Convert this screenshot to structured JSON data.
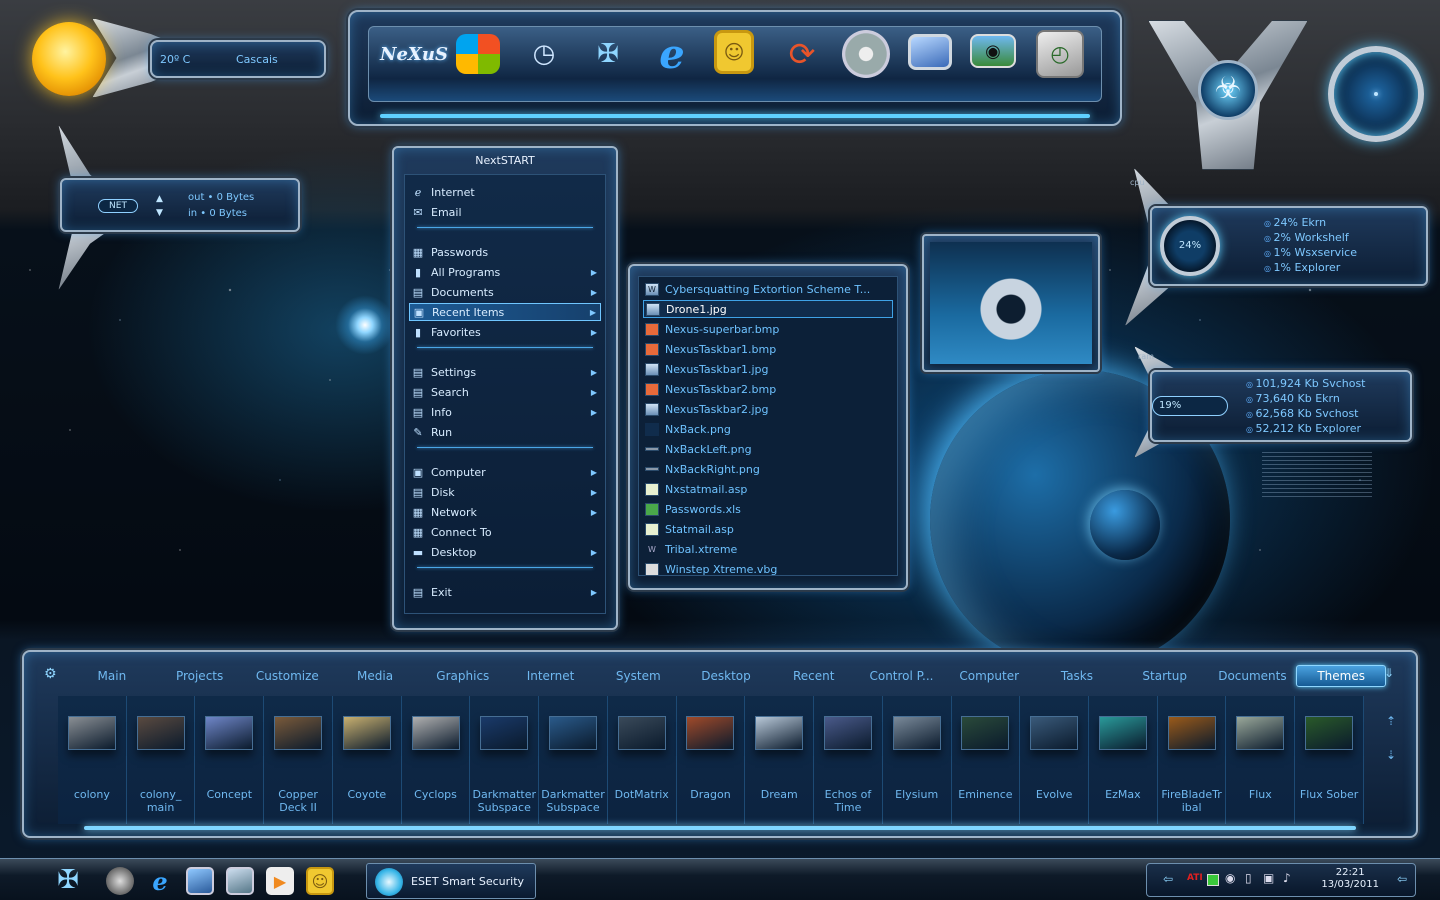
{
  "weather": {
    "temp": "20º C",
    "city": "Cascais"
  },
  "net": {
    "badge": "NET",
    "out": "out • 0 Bytes",
    "in": "in • 0 Bytes"
  },
  "dock": {
    "logo": "NeXuS",
    "icons": [
      "windows-logo-icon",
      "clock-tool-icon",
      "nexus-emblem-icon",
      "internet-explorer-icon",
      "photo-frame-icon",
      "refresh-arrows-icon",
      "cd-disc-icon",
      "monitor-icon",
      "camera-icon",
      "clock-monitor-icon"
    ]
  },
  "menu": {
    "title": "NextSTART",
    "items": [
      {
        "label": "Internet",
        "icon": "ie-icon",
        "arrow": false
      },
      {
        "label": "Email",
        "icon": "email-icon",
        "arrow": false
      },
      {
        "label": "Passwords",
        "icon": "passwords-icon",
        "arrow": false
      },
      {
        "label": "All Programs",
        "icon": "folder-icon",
        "arrow": true
      },
      {
        "label": "Documents",
        "icon": "documents-icon",
        "arrow": true
      },
      {
        "label": "Recent Items",
        "icon": "recent-icon",
        "arrow": true
      },
      {
        "label": "Favorites",
        "icon": "favorites-icon",
        "arrow": true
      },
      {
        "label": "Settings",
        "icon": "settings-icon",
        "arrow": true
      },
      {
        "label": "Search",
        "icon": "search-icon",
        "arrow": true
      },
      {
        "label": "Info",
        "icon": "info-icon",
        "arrow": true
      },
      {
        "label": "Run",
        "icon": "run-icon",
        "arrow": false
      },
      {
        "label": "Computer",
        "icon": "computer-icon",
        "arrow": true
      },
      {
        "label": "Disk",
        "icon": "disk-icon",
        "arrow": true
      },
      {
        "label": "Network",
        "icon": "network-icon",
        "arrow": true
      },
      {
        "label": "Connect To",
        "icon": "connect-icon",
        "arrow": false
      },
      {
        "label": "Desktop",
        "icon": "desktop-icon",
        "arrow": true
      },
      {
        "label": "Exit",
        "icon": "exit-icon",
        "arrow": true
      }
    ]
  },
  "recent": {
    "items": [
      "Cybersquatting Extortion Scheme T...",
      "Drone1.jpg",
      "Nexus-superbar.bmp",
      "NexusTaskbar1.bmp",
      "NexusTaskbar1.jpg",
      "NexusTaskbar2.bmp",
      "NexusTaskbar2.jpg",
      "NxBack.png",
      "NxBackLeft.png",
      "NxBackRight.png",
      "Nxstatmail.asp",
      "Passwords.xls",
      "Statmail.asp",
      "Tribal.xtreme",
      "Winstep Xtreme.vbg"
    ]
  },
  "cpu": {
    "tag": "cpu",
    "percent": "24%",
    "lines": [
      "24% Ekrn",
      "2% Workshelf",
      "1% Wsxservice",
      "1% Explorer"
    ]
  },
  "ram": {
    "tag": "ram",
    "percent": "19%",
    "lines": [
      "101,924 Kb Svchost",
      "73,640 Kb Ekrn",
      "62,568 Kb Svchost",
      "52,212 Kb Explorer"
    ]
  },
  "launcher": {
    "tabs": [
      "Main",
      "Projects",
      "Customize",
      "Media",
      "Graphics",
      "Internet",
      "System",
      "Desktop",
      "Recent",
      "Control P...",
      "Computer",
      "Tasks",
      "Startup",
      "Documents",
      "Themes"
    ],
    "tiles": [
      {
        "label": "colony",
        "color": "#8a8f94"
      },
      {
        "label": "colony_ main",
        "color": "#5a4a40"
      },
      {
        "label": "Concept",
        "color": "#6f86c8"
      },
      {
        "label": "Copper Deck II",
        "color": "#7a5a3a"
      },
      {
        "label": "Coyote",
        "color": "#c8b070"
      },
      {
        "label": "Cyclops",
        "color": "#b0b0b0"
      },
      {
        "label": "Darkmatter Subspace",
        "color": "#1a3a6a"
      },
      {
        "label": "Darkmatter Subspace",
        "color": "#2a5a8a"
      },
      {
        "label": "DotMatrix",
        "color": "#3a4a5a"
      },
      {
        "label": "Dragon",
        "color": "#a04a2a"
      },
      {
        "label": "Dream",
        "color": "#b8c8d8"
      },
      {
        "label": "Echos of Time",
        "color": "#4a5a8a"
      },
      {
        "label": "Elysium",
        "color": "#7a8a9a"
      },
      {
        "label": "Eminence",
        "color": "#2a4a3a"
      },
      {
        "label": "Evolve",
        "color": "#3a5a7a"
      },
      {
        "label": "EzMax",
        "color": "#2a9a9a"
      },
      {
        "label": "FireBladeTr ibal",
        "color": "#9a5a1a"
      },
      {
        "label": "Flux",
        "color": "#9aa89a"
      },
      {
        "label": "Flux Sober",
        "color": "#2a5a2a"
      }
    ]
  },
  "taskbar": {
    "task": "ESET Smart Security",
    "tray_badge": "ATI",
    "time": "22:21",
    "date": "13/03/2011"
  }
}
